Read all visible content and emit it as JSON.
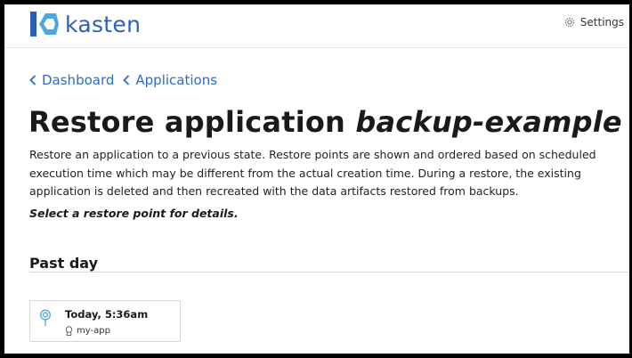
{
  "header": {
    "logo_text": "kasten",
    "settings_label": "Settings"
  },
  "breadcrumb": [
    {
      "label": "Dashboard"
    },
    {
      "label": "Applications"
    }
  ],
  "page": {
    "title_prefix": "Restore application",
    "app_name": "backup-example",
    "description": "Restore an application to a previous state. Restore points are shown and ordered based on scheduled execution time which may be different from the actual creation time. During a restore, the existing application is deleted and then recreated with the data artifacts restored from backups.",
    "hint": "Select a restore point for details."
  },
  "restore_points": {
    "section_title": "Past day",
    "items": [
      {
        "time": "Today, 5:36am",
        "app": "my-app",
        "icon": "pin-icon"
      }
    ]
  },
  "colors": {
    "brand": "#2e5fb8",
    "link": "#2e6bc4",
    "pin": "#5aa9d6"
  }
}
